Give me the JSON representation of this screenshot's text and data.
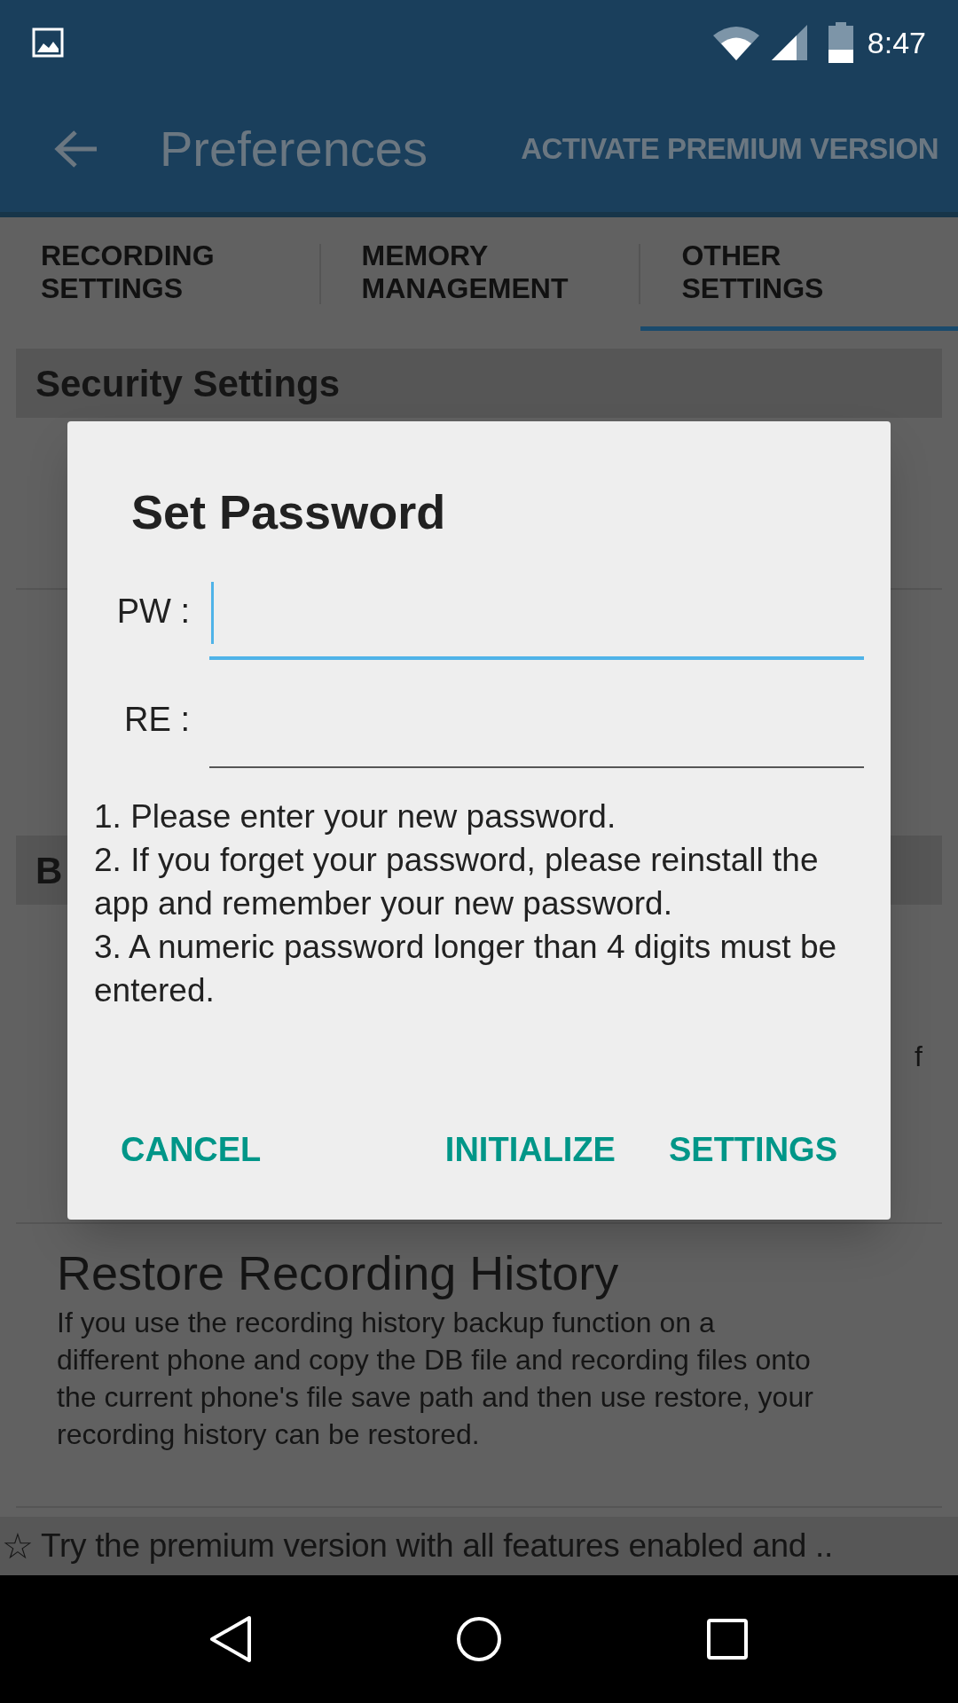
{
  "status_bar": {
    "time": "8:47"
  },
  "toolbar": {
    "title": "Preferences",
    "action": "ACTIVATE PREMIUM VERSION"
  },
  "tabs": [
    {
      "label": "RECORDING SETTINGS",
      "selected": false
    },
    {
      "label": "MEMORY MANAGEMENT",
      "selected": false
    },
    {
      "label": "OTHER SETTINGS",
      "selected": true
    }
  ],
  "sections": [
    {
      "header": "Security Settings"
    },
    {
      "header": "B",
      "items": [
        {
          "lines": [
            {
              "right": "f"
            }
          ]
        },
        {
          "title": "Restore Recording History",
          "lines": [
            {
              "left": "If you use the recording history backup function on a"
            },
            {
              "left": "different phone and copy the DB file and recording files onto"
            },
            {
              "left": "the current phone's file save path and then use restore, your"
            },
            {
              "left": "recording history can be restored."
            }
          ]
        }
      ]
    }
  ],
  "banner": {
    "star": "☆",
    "text": "Try the premium version with all features enabled and .."
  },
  "dialog": {
    "title": "Set Password",
    "fields": [
      {
        "label": "PW :",
        "focused": true
      },
      {
        "label": "RE :",
        "focused": false
      }
    ],
    "notes": [
      "1. Please enter your new password.",
      "2. If you forget your password, please reinstall the app and remember your new password.",
      "3. A numeric password longer than 4 digits must be entered."
    ],
    "buttons": [
      "CANCEL",
      "INITIALIZE",
      "SETTINGS"
    ]
  }
}
